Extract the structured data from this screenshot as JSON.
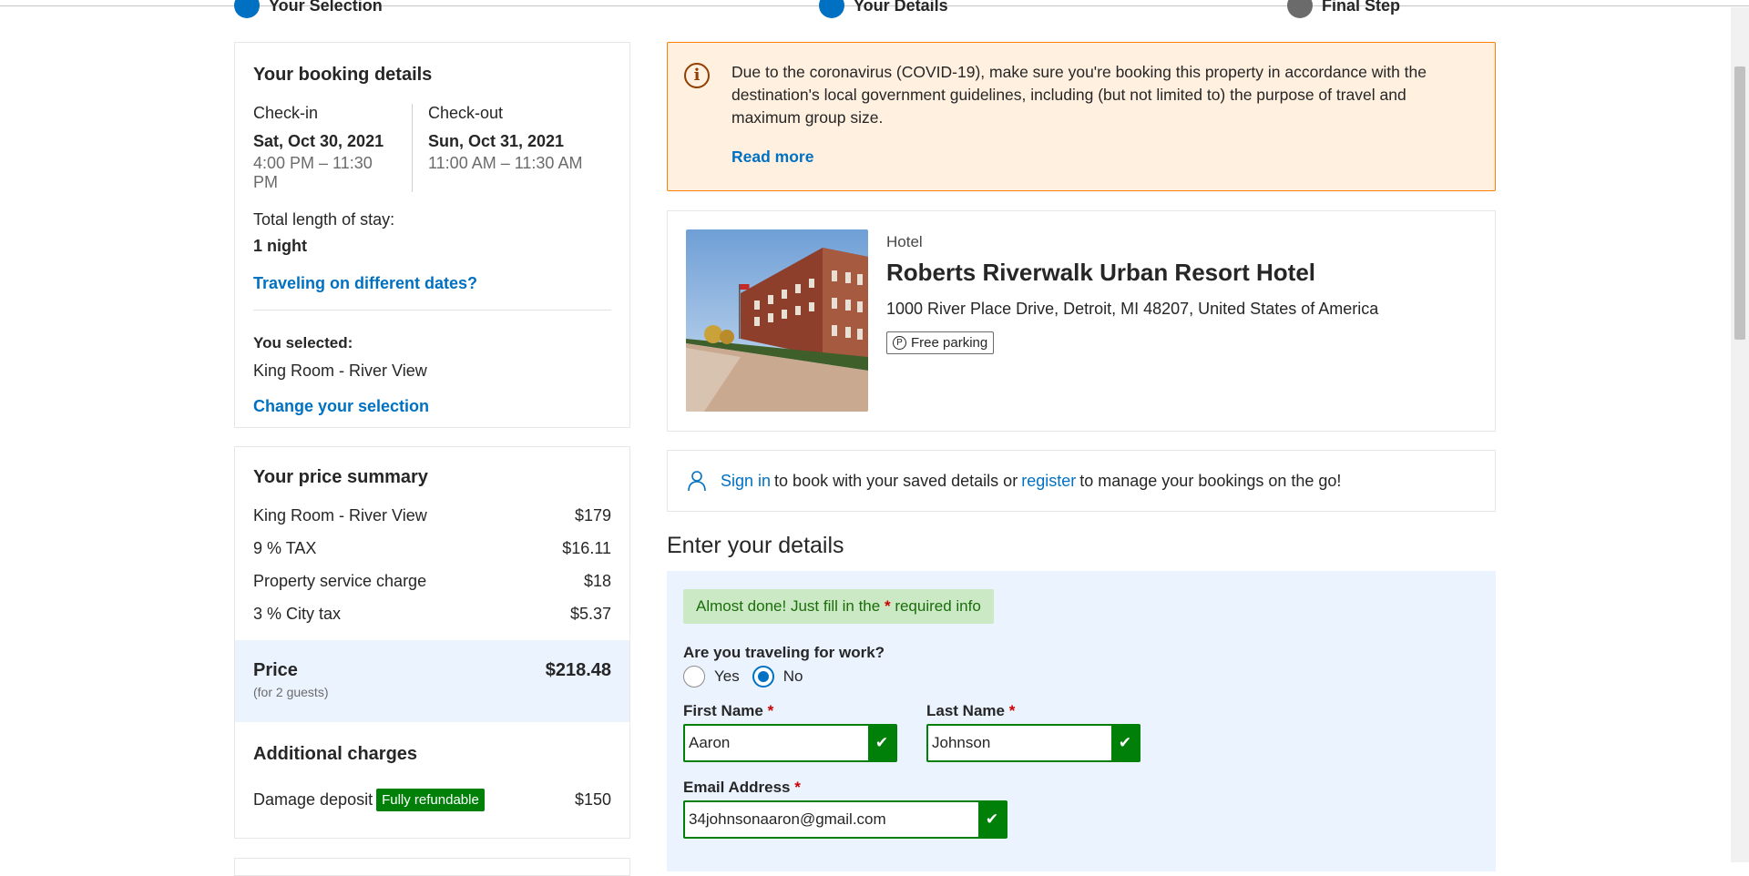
{
  "steps": [
    {
      "label": "Your Selection"
    },
    {
      "label": "Your Details"
    },
    {
      "label": "Final Step"
    }
  ],
  "booking": {
    "title": "Your booking details",
    "checkin_label": "Check-in",
    "checkin_date": "Sat, Oct 30, 2021",
    "checkin_time": "4:00 PM – 11:30 PM",
    "checkout_label": "Check-out",
    "checkout_date": "Sun, Oct 31, 2021",
    "checkout_time": "11:00 AM – 11:30 AM",
    "stay_label": "Total length of stay:",
    "stay_value": "1 night",
    "different_dates": "Traveling on different dates?",
    "selected_label": "You selected:",
    "selected_value": "King Room - River View",
    "change_selection": "Change your selection"
  },
  "price": {
    "title": "Your price summary",
    "rows": [
      {
        "label": "King Room - River View",
        "value": "$179"
      },
      {
        "label": "9 % TAX",
        "value": "$16.11"
      },
      {
        "label": "Property service charge",
        "value": "$18"
      },
      {
        "label": "3 % City tax",
        "value": "$5.37"
      }
    ],
    "total_label": "Price",
    "total_sub": "(for 2 guests)",
    "total_value": "$218.48",
    "additional_title": "Additional charges",
    "deposit_label": "Damage deposit",
    "deposit_badge": "Fully refundable",
    "deposit_value": "$150"
  },
  "covid": {
    "text": "Due to the coronavirus (COVID-19), make sure you're booking this property in accordance with the destination's local government guidelines, including (but not limited to) the purpose of travel and maximum group size.",
    "read_more": "Read more"
  },
  "hotel": {
    "type": "Hotel",
    "name": "Roberts Riverwalk Urban Resort Hotel",
    "address": "1000 River Place Drive, Detroit, MI 48207, United States of America",
    "parking_icon": "P",
    "parking": "Free parking"
  },
  "signin": {
    "sign_in": "Sign in",
    "text1": "to book with your saved details or",
    "register": "register",
    "text2": "to manage your bookings on the go!"
  },
  "form": {
    "heading": "Enter your details",
    "alert_pre": "Almost done! Just fill in the",
    "alert_star": "*",
    "alert_post": "required info",
    "work_question": "Are you traveling for work?",
    "yes": "Yes",
    "no": "No",
    "first_name_label": "First Name",
    "first_name_value": "Aaron",
    "last_name_label": "Last Name",
    "last_name_value": "Johnson",
    "email_label": "Email Address",
    "email_value": "34johnsonaaron@gmail.com",
    "required_mark": "*",
    "check": "✔"
  },
  "colors": {
    "accent": "#0071c2",
    "success": "#008009",
    "warning_bg": "#fff0e0",
    "warning_border": "#ff8000"
  }
}
